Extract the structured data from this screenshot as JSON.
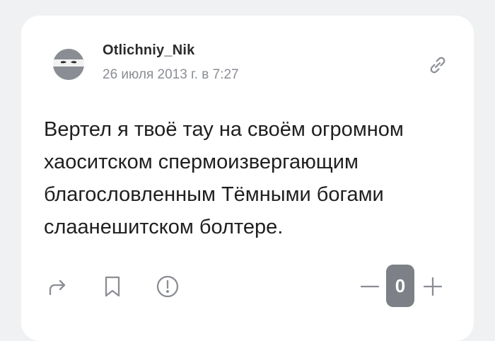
{
  "post": {
    "author": "Otlichniy_Nik",
    "date": "26 июля 2013 г. в 7:27",
    "text": "Вертел я твоё тау на своём огромном хаоситском спермоизвергающим благословленным Тёмными богами слаанешитском болтере.",
    "rating": "0"
  },
  "icons": {
    "avatar": "ninja-avatar-icon",
    "link": "link-icon",
    "share": "share-arrow-icon",
    "bookmark": "bookmark-icon",
    "report": "exclamation-circle-icon",
    "minus": "minus-icon",
    "plus": "plus-icon"
  },
  "colors": {
    "background": "#f0f1f3",
    "card": "#ffffff",
    "icon": "#8a8d93",
    "rating_bg": "#7d8187"
  }
}
